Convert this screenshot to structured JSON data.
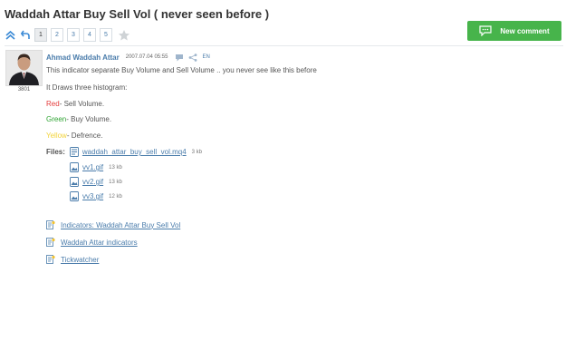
{
  "page": {
    "title": "Waddah Attar Buy Sell Vol ( never seen before )"
  },
  "pager": {
    "pages": [
      "1",
      "2",
      "3",
      "4",
      "5"
    ],
    "active_page": "1"
  },
  "new_comment": {
    "label": "New comment"
  },
  "post": {
    "author": "Ahmad Waddah Attar",
    "date": "2007.07.04 05:55",
    "lang": "EN",
    "rating": "3801",
    "lines": {
      "intro": "This indicator separate Buy Volume and Sell Volume .. you never see like this before",
      "draws": "It Draws three histogram:",
      "red_word": "Red",
      "red_text": "- Sell Volume.",
      "green_word": "Green",
      "green_text": "- Buy Volume.",
      "yellow_word": "Yellow",
      "yellow_text": "- Defrence."
    },
    "files_label": "Files:",
    "files": [
      {
        "name": "waddah_attar_buy_sell_vol.mq4",
        "size": "3 kb",
        "icon": "mq4-file-icon"
      },
      {
        "name": "vv1.gif",
        "size": "13 kb",
        "icon": "image-file-icon"
      },
      {
        "name": "vv2.gif",
        "size": "13 kb",
        "icon": "image-file-icon"
      },
      {
        "name": "vv3.gif",
        "size": "12 kb",
        "icon": "image-file-icon"
      }
    ]
  },
  "links": [
    {
      "text": "Indicators: Waddah Attar Buy Sell Vol",
      "icon": "article-icon"
    },
    {
      "text": "Waddah Attar indicators",
      "icon": "article-icon"
    },
    {
      "text": "Tickwatcher",
      "icon": "article-icon"
    }
  ],
  "colors": {
    "accent": "#47b44b",
    "link": "#4a7cab",
    "red": "#e43a3a",
    "green": "#2fa433",
    "yellow": "#f2d33a"
  }
}
